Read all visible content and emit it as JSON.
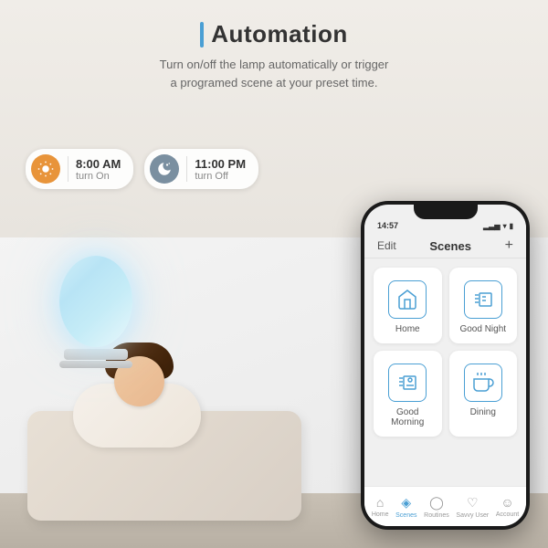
{
  "header": {
    "title": "Automation",
    "subtitle_line1": "Turn on/off the lamp automatically or trigger",
    "subtitle_line2": "a programed scene at your preset time."
  },
  "schedule": {
    "on_badge": {
      "time": "8:00 AM",
      "action": "turn On",
      "icon": "☀"
    },
    "off_badge": {
      "time": "11:00 PM",
      "action": "turn Off",
      "icon": "🌙"
    }
  },
  "phone": {
    "status_time": "14:57",
    "app_title": "Scenes",
    "edit_label": "Edit",
    "plus_label": "+",
    "scenes": [
      {
        "label": "Home",
        "icon": "🏠"
      },
      {
        "label": "Good Night",
        "icon": "🛏"
      },
      {
        "label": "Good Morning",
        "icon": "🌅"
      },
      {
        "label": "Dining",
        "icon": "🍽"
      }
    ],
    "nav_items": [
      {
        "label": "Home",
        "icon": "⌂",
        "active": false
      },
      {
        "label": "Scenes",
        "icon": "◈",
        "active": true
      },
      {
        "label": "Routines",
        "icon": "○",
        "active": false
      },
      {
        "label": "Savvy User",
        "icon": "♡",
        "active": false
      },
      {
        "label": "Account",
        "icon": "☺",
        "active": false
      }
    ]
  },
  "colors": {
    "accent_blue": "#4a9fd4",
    "sunrise_orange": "#e8943a",
    "moon_gray": "#7a8fa0"
  }
}
